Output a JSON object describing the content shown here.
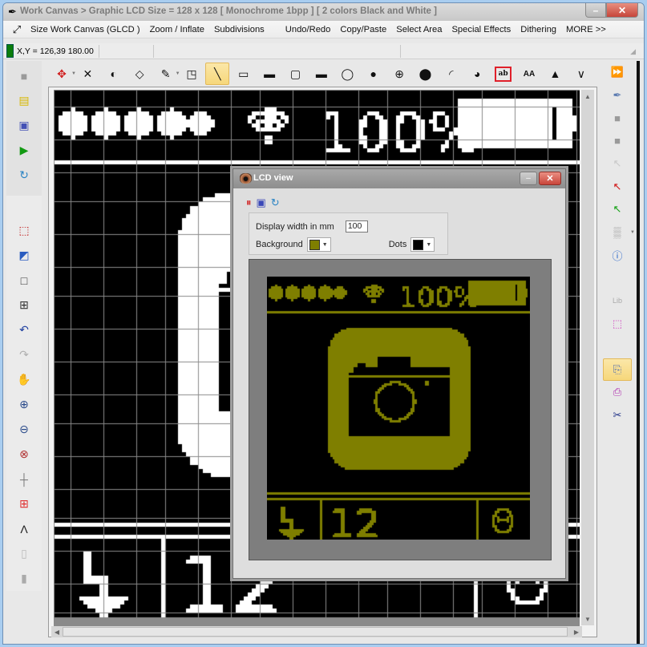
{
  "window": {
    "title": "Work Canvas > Graphic LCD Size = 128 x 128 [ Monochrome 1bpp ] [ 2 colors Black and White ]",
    "minimize_glyph": "–",
    "close_glyph": "✕"
  },
  "menu": {
    "items": [
      "Size Work Canvas (GLCD )",
      "Zoom / Inflate",
      "Subdivisions",
      "Undo/Redo",
      "Copy/Paste",
      "Select Area",
      "Special Effects",
      "Dithering",
      "MORE >>"
    ]
  },
  "status": {
    "coords": "X,Y = 126,39  180.00",
    "color": "#0b7d0b"
  },
  "toolbar": {
    "tools": [
      {
        "name": "select-move-icon",
        "glyph": "✥",
        "color": "#d02020",
        "caret": true
      },
      {
        "name": "delete-icon",
        "glyph": "✕"
      },
      {
        "name": "flip-icon",
        "glyph": "◐"
      },
      {
        "name": "eraser-icon",
        "glyph": "◇"
      },
      {
        "name": "pen-icon",
        "glyph": "✎",
        "caret": true
      },
      {
        "name": "color-swap-icon",
        "glyph": "◳"
      },
      {
        "name": "line-icon",
        "glyph": "╲",
        "active": true
      },
      {
        "name": "rectangle-icon",
        "glyph": "▭"
      },
      {
        "name": "filled-rectangle-icon",
        "glyph": "▬"
      },
      {
        "name": "rounded-rectangle-icon",
        "glyph": "▢"
      },
      {
        "name": "filled-rounded-rectangle-icon",
        "glyph": "▬"
      },
      {
        "name": "ellipse-icon",
        "glyph": "◯"
      },
      {
        "name": "filled-ellipse-icon",
        "glyph": "●"
      },
      {
        "name": "circle-cross-icon",
        "glyph": "⊕"
      },
      {
        "name": "filled-circle-cross-icon",
        "glyph": "⬤"
      },
      {
        "name": "arc-icon",
        "glyph": "◜"
      },
      {
        "name": "pie-icon",
        "glyph": "◕"
      },
      {
        "name": "text-tool-icon",
        "glyph": "ab",
        "boxed": true
      },
      {
        "name": "font-size-icon",
        "glyph": "AA"
      },
      {
        "name": "triangle-icon",
        "glyph": "▲"
      },
      {
        "name": "polyline-icon",
        "glyph": "∨"
      }
    ]
  },
  "leftbar": {
    "group1": [
      {
        "name": "plugin-icon",
        "glyph": "■",
        "color": "#9a9a9a"
      },
      {
        "name": "open-folder-icon",
        "glyph": "▤",
        "color": "#d8b800"
      },
      {
        "name": "save-icon",
        "glyph": "▣",
        "color": "#4350b5"
      },
      {
        "name": "play-icon",
        "glyph": "▶",
        "color": "#139a13"
      },
      {
        "name": "refresh-icon",
        "glyph": "↻",
        "color": "#2b84c4"
      }
    ],
    "group2": [
      {
        "name": "resize-canvas-icon",
        "glyph": "⬚",
        "color": "#c02020"
      },
      {
        "name": "import-icon",
        "glyph": "◩",
        "color": "#2a5cc0"
      },
      {
        "name": "grid-off-icon",
        "glyph": "□",
        "color": "#333"
      },
      {
        "name": "grid-on-icon",
        "glyph": "⊞",
        "color": "#333"
      },
      {
        "name": "undo-icon",
        "glyph": "↶",
        "color": "#2040a0"
      },
      {
        "name": "redo-icon",
        "glyph": "↷",
        "color": "#b0b0b0"
      },
      {
        "name": "pan-hand-icon",
        "glyph": "✋",
        "color": "#888"
      },
      {
        "name": "zoom-in-icon",
        "glyph": "⊕",
        "color": "#2a4a8a"
      },
      {
        "name": "zoom-out-icon",
        "glyph": "⊖",
        "color": "#2a4a8a"
      },
      {
        "name": "zoom-reset-icon",
        "glyph": "⊗",
        "color": "#b03030"
      },
      {
        "name": "crosshair-icon",
        "glyph": "┼",
        "color": "#777"
      },
      {
        "name": "red-grid-icon",
        "glyph": "⊞",
        "color": "#e03030"
      },
      {
        "name": "compass-icon",
        "glyph": "Λ",
        "color": "#222"
      },
      {
        "name": "new-page-icon",
        "glyph": "▯",
        "color": "#bbb"
      },
      {
        "name": "page-icon",
        "glyph": "▮",
        "color": "#aaa"
      }
    ]
  },
  "rightbar": {
    "items": [
      {
        "name": "fast-forward-icon",
        "glyph": "⏩",
        "color": "#2c4fd0"
      },
      {
        "name": "eyedropper-icon",
        "glyph": "✒",
        "color": "#5a7ab0"
      },
      {
        "name": "gray-square-icon-1",
        "glyph": "■",
        "color": "#9a9a9a"
      },
      {
        "name": "gray-square-icon-2",
        "glyph": "■",
        "color": "#9a9a9a"
      },
      {
        "name": "cursor-disabled-icon",
        "glyph": "↖",
        "color": "#c8c8c8"
      },
      {
        "name": "cursor-add-red-icon",
        "glyph": "↖",
        "color": "#d01010"
      },
      {
        "name": "cursor-remove-green-icon",
        "glyph": "↖",
        "color": "#12a012"
      },
      {
        "name": "checker-pattern-icon",
        "glyph": "▒",
        "color": "#999",
        "caret": true
      },
      {
        "name": "info-icon",
        "glyph": "ⓘ",
        "color": "#1a5cc8"
      },
      {
        "name": "spacer",
        "glyph": ""
      },
      {
        "name": "lib-add-icon",
        "glyph": "Lib",
        "color": "#aaa"
      },
      {
        "name": "select-region-icon",
        "glyph": "⬚",
        "color": "#d040c0"
      },
      {
        "name": "spacer",
        "glyph": ""
      },
      {
        "name": "copy-icon",
        "glyph": "⎘",
        "color": "#4a6ab0",
        "active": true
      },
      {
        "name": "paste-icon",
        "glyph": "⎙",
        "color": "#b030b0"
      },
      {
        "name": "cut-icon",
        "glyph": "✂",
        "color": "#223388"
      }
    ]
  },
  "canvas": {
    "lcd_width": 128,
    "lcd_height": 128,
    "on_color": "#ffffff",
    "off_color": "#000000",
    "grid_color": "#8a8a8a",
    "scroll_position": 0
  },
  "lcd_content": {
    "signal_dots": 5,
    "battery_percent_text": "100%",
    "battery_level": 1.0,
    "counter_text": "12",
    "icon": "camera"
  },
  "lcd_view": {
    "title": "LCD view",
    "tools": [
      {
        "name": "pause-icon",
        "glyph": "⏸",
        "color": "#d02020"
      },
      {
        "name": "save-icon",
        "glyph": "▣",
        "color": "#3a48b8"
      },
      {
        "name": "refresh-icon",
        "glyph": "↻",
        "color": "#2b84c4"
      }
    ],
    "display_width_label": "Display width in mm",
    "display_width_value": "100",
    "background_label": "Background",
    "background_color": "#7f7f00",
    "dots_label": "Dots",
    "dots_color": "#000000"
  }
}
